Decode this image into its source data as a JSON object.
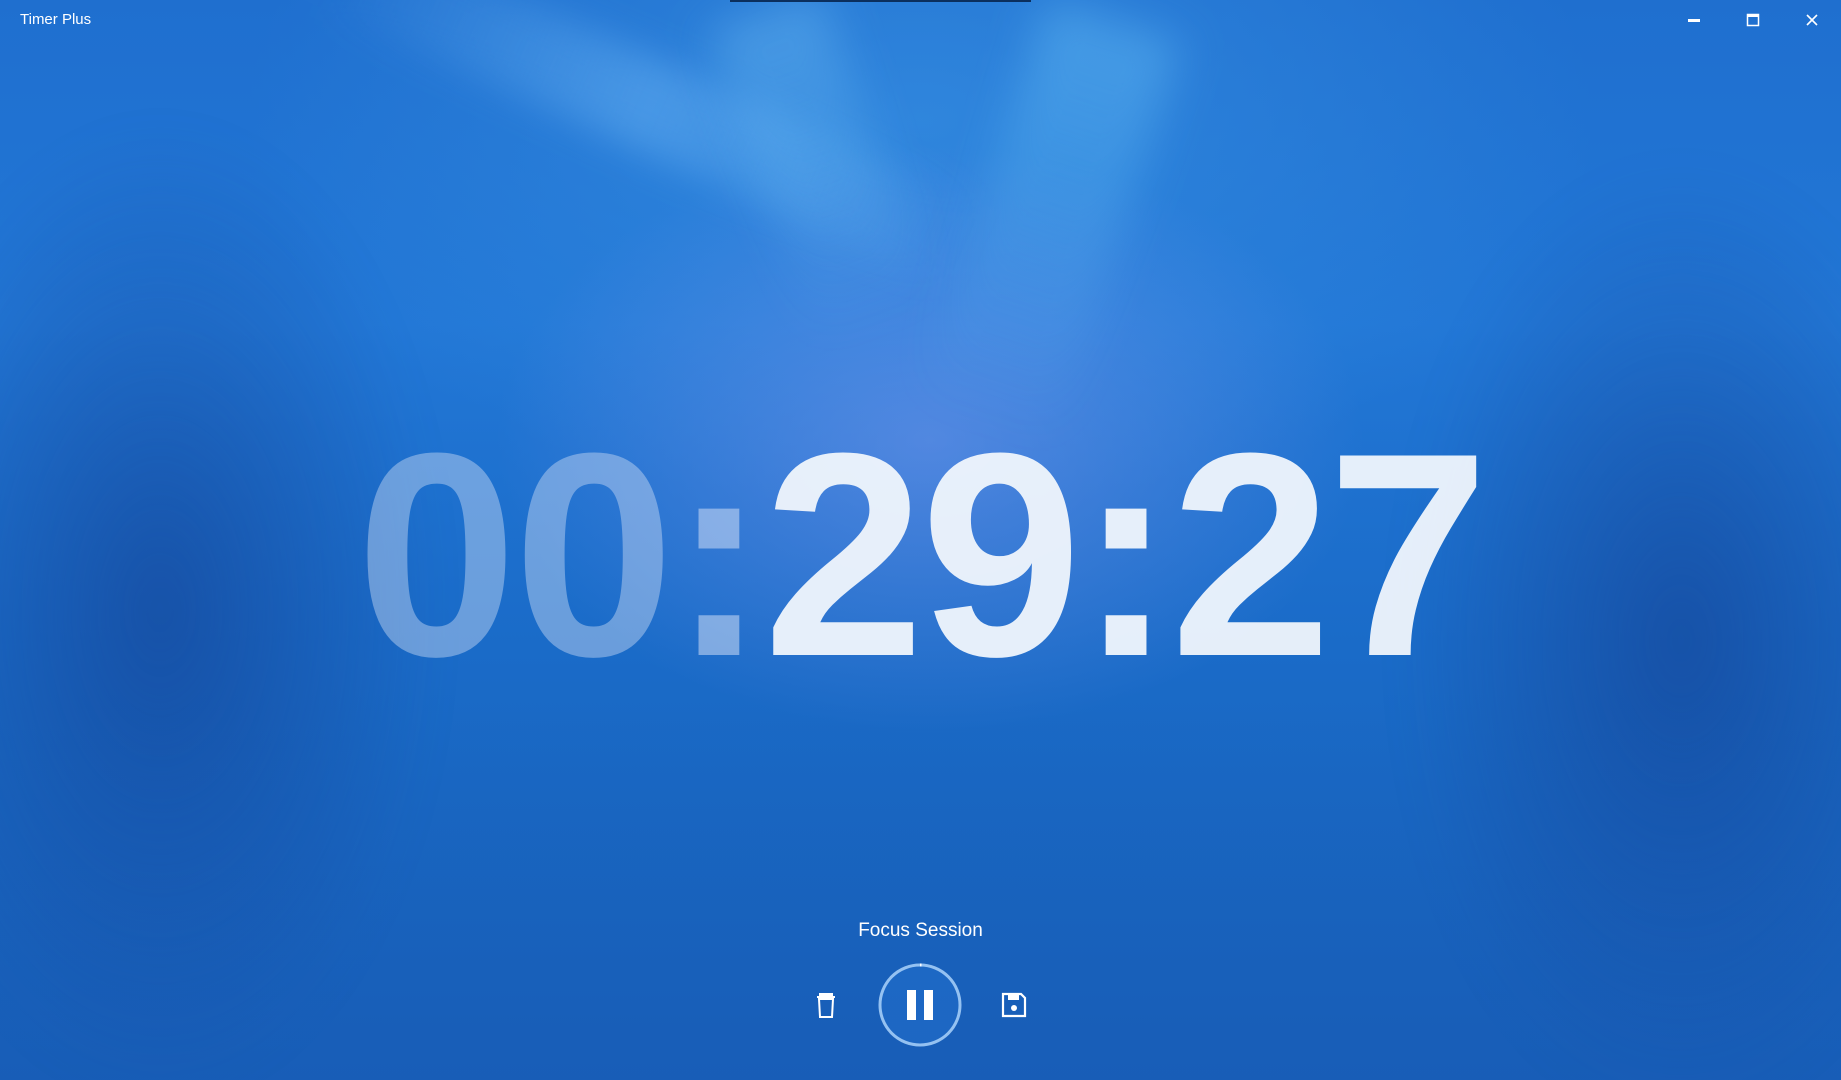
{
  "window": {
    "title": "Timer Plus",
    "controls": {
      "minimize_icon": "minimize-icon",
      "maximize_icon": "maximize-icon",
      "close_icon": "close-icon"
    }
  },
  "timer": {
    "hours": "00",
    "minutes": "29",
    "seconds": "27",
    "separator": ":"
  },
  "session": {
    "label": "Focus Session"
  },
  "controls": {
    "delete_icon": "trash-icon",
    "pause_icon": "pause-icon",
    "save_icon": "save-icon"
  },
  "colors": {
    "background": "#1f6fcf",
    "accent_ring": "#2a7fe0",
    "text": "#ffffff"
  }
}
